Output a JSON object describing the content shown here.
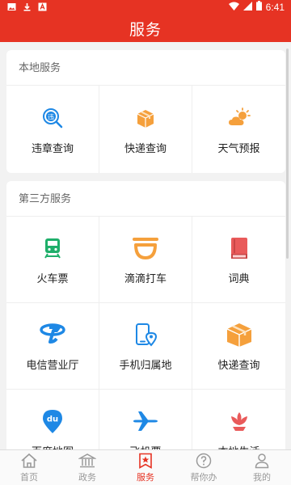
{
  "status_bar": {
    "time": "6:41",
    "left_icons": [
      "image-icon",
      "download-icon",
      "app-icon"
    ],
    "right_icons": [
      "wifi-icon",
      "signal-icon",
      "battery-icon"
    ]
  },
  "header": {
    "title": "服务"
  },
  "local_services": {
    "title": "本地服务",
    "items": [
      {
        "label": "违章查询",
        "icon": "violation-search-icon"
      },
      {
        "label": "快递查询",
        "icon": "package-icon"
      },
      {
        "label": "天气预报",
        "icon": "weather-icon"
      }
    ]
  },
  "third_party": {
    "title": "第三方服务",
    "items": [
      {
        "label": "火车票",
        "icon": "train-icon"
      },
      {
        "label": "滴滴打车",
        "icon": "didi-icon"
      },
      {
        "label": "词典",
        "icon": "dictionary-icon"
      },
      {
        "label": "电信营业厅",
        "icon": "telecom-icon"
      },
      {
        "label": "手机归属地",
        "icon": "phone-location-icon"
      },
      {
        "label": "快递查询",
        "icon": "package-icon"
      },
      {
        "label": "百度地图",
        "icon": "baidu-map-icon"
      },
      {
        "label": "飞机票",
        "icon": "airplane-icon"
      },
      {
        "label": "本地生活",
        "icon": "lotus-icon"
      }
    ]
  },
  "bottom_nav": {
    "items": [
      {
        "label": "首页",
        "icon": "home-icon"
      },
      {
        "label": "政务",
        "icon": "government-icon"
      },
      {
        "label": "服务",
        "icon": "service-icon"
      },
      {
        "label": "帮你办",
        "icon": "help-icon"
      },
      {
        "label": "我的",
        "icon": "user-icon"
      }
    ],
    "active": "服务"
  },
  "colors": {
    "brand_red": "#e63323",
    "icon_blue": "#1e88e5",
    "icon_orange": "#f5a03c",
    "icon_green": "#1faf6a",
    "icon_pink": "#e95a5a"
  }
}
